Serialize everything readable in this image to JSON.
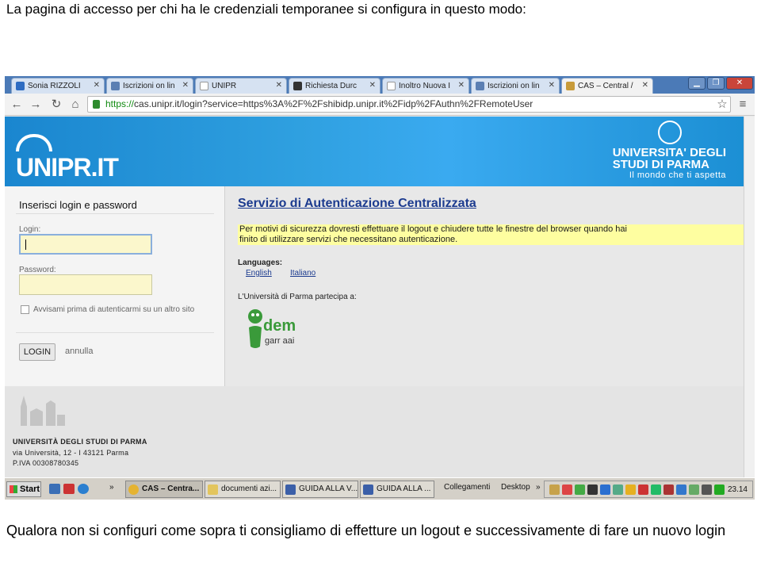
{
  "document": {
    "top_caption": "La pagina di accesso per chi ha le credenziali temporanee si configura in questo modo:",
    "bottom_caption": "Qualora non si configuri come sopra ti consigliamo di effetture un logout e successivamente di fare un nuovo login"
  },
  "browser": {
    "tabs": [
      {
        "label": "Sonia RIZZOLI",
        "icon": "outlook-icon",
        "active": false
      },
      {
        "label": "Iscrizioni on lin",
        "icon": "page-icon",
        "active": false
      },
      {
        "label": "UNIPR",
        "icon": "blank-page-icon",
        "active": false
      },
      {
        "label": "Richiesta Durc",
        "icon": "home-icon",
        "active": false
      },
      {
        "label": "Inoltro Nuova I",
        "icon": "blank-page-icon",
        "active": false
      },
      {
        "label": "Iscrizioni on lin",
        "icon": "page-icon",
        "active": false
      },
      {
        "label": "CAS – Central /",
        "icon": "cas-icon",
        "active": true
      }
    ],
    "url_scheme": "https://",
    "url_rest": "cas.unipr.it/login?service=https%3A%2F%2Fshibidp.unipr.it%2Fidp%2FAuthn%2FRemoteUser"
  },
  "page": {
    "logo": "UNIPR.IT",
    "university_name_line1": "UNIVERSITA' DEGLI",
    "university_name_line2": "STUDI DI PARMA",
    "motto": "Il mondo che ti aspetta",
    "login": {
      "title": "Inserisci login e password",
      "login_label": "Login:",
      "password_label": "Password:",
      "warn_label": "Avvisami prima di autenticarmi su un altro sito",
      "login_button": "LOGIN",
      "cancel_link": "annulla"
    },
    "service_title": "Servizio di Autenticazione Centralizzata",
    "security_notice_line1": "Per motivi di sicurezza dovresti effettuare il logout e chiudere tutte le finestre del browser quando hai",
    "security_notice_line2": "finito di utilizzare servizi che necessitano autenticazione.",
    "languages_title": "Languages:",
    "languages": [
      "English",
      "Italiano"
    ],
    "partner_text": "L'Università di Parma partecipa a:",
    "footer": {
      "name": "UNIVERSITÀ DEGLI STUDI DI PARMA",
      "address": "via Università, 12 - I 43121 Parma",
      "vat": "P.IVA 00308780345"
    }
  },
  "taskbar": {
    "start_label": "Start",
    "tasks": [
      {
        "label": "CAS – Centra...",
        "icon": "chrome-icon",
        "active": true
      },
      {
        "label": "documenti azi...",
        "icon": "folder-icon",
        "active": false
      },
      {
        "label": "GUIDA ALLA V...",
        "icon": "word-icon",
        "active": false
      },
      {
        "label": "GUIDA ALLA ...",
        "icon": "word-icon",
        "active": false
      }
    ],
    "links_label": "Collegamenti",
    "desktop_label": "Desktop",
    "clock": "23.14"
  },
  "colors": {
    "banner_blue": "#1c8fd4",
    "title_blue": "#1c3b8f",
    "notice_yellow": "#fefea0",
    "field_yellow": "#fbf7cc",
    "idem_green": "#3a9a3a"
  }
}
